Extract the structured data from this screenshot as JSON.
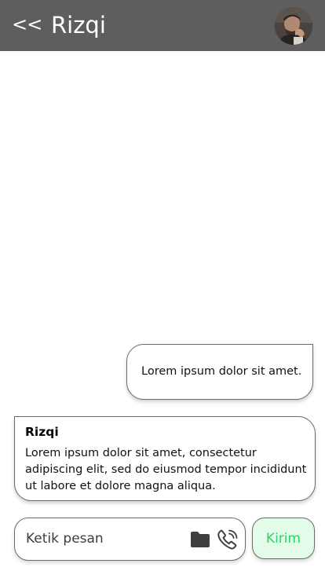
{
  "header": {
    "back_label": "<<",
    "contact_name": "Rizqi",
    "avatar_icon": "user-avatar-photo"
  },
  "messages": [
    {
      "direction": "outgoing",
      "text": "Lorem ipsum dolor sit amet."
    },
    {
      "direction": "incoming",
      "sender": "Rizqi",
      "text": "Lorem ipsum dolor sit amet, consectetur adipiscing elit, sed do eiusmod tempor incididunt ut labore et dolore magna aliqua."
    }
  ],
  "composer": {
    "placeholder": "Ketik pesan",
    "value": "",
    "attach_icon": "folder-icon",
    "call_icon": "phone-icon",
    "send_label": "Kirim"
  },
  "colors": {
    "header_bg": "#5e5e5e",
    "send_bg": "#e3fbe9",
    "send_text": "#2fd36b"
  }
}
